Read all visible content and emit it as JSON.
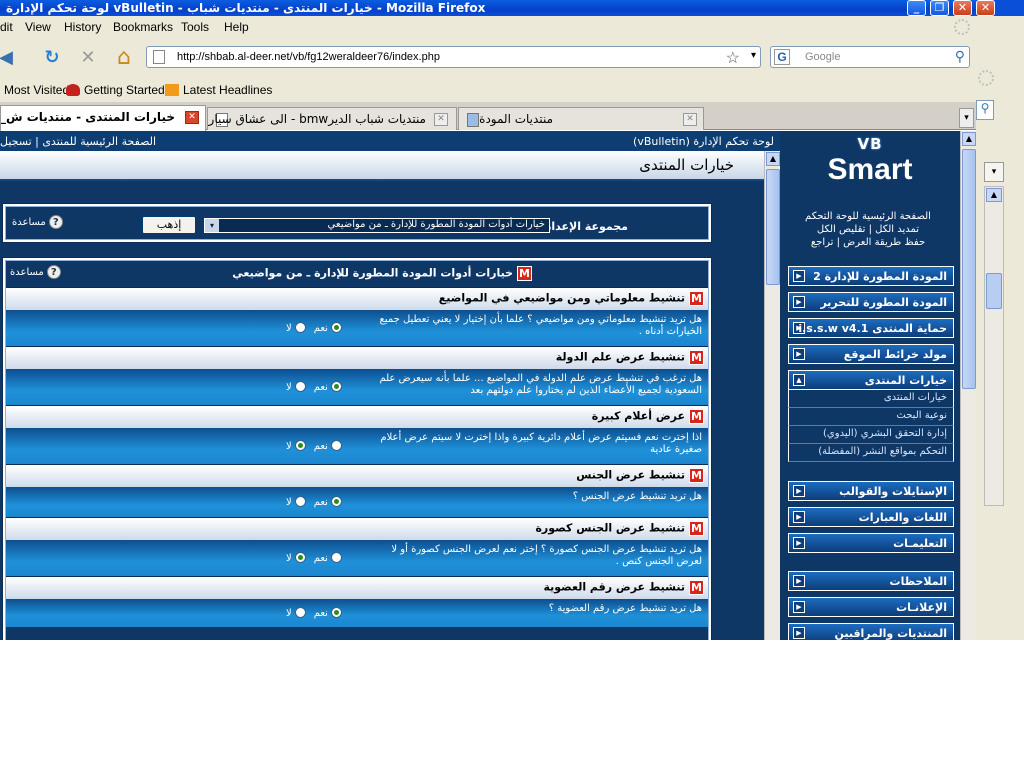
{
  "window": {
    "title": "لوحة تحكم الإدارة vBulletin - خيارات المنتدى - منتديات شباب - Mozilla Firefox",
    "minimize_glyph": "_",
    "maximize_glyph": "❐",
    "close_glyph": "✕"
  },
  "menu": [
    "dit",
    "View",
    "History",
    "Bookmarks",
    "Tools",
    "Help"
  ],
  "nav": {
    "back_glyph": "◀",
    "reload_glyph": "↻",
    "stop_glyph": "✕",
    "home_glyph": "⌂",
    "url": "http://shbab.al-deer.net/vb/fg12weraldeer76/index.php",
    "star_glyph": "☆",
    "dropdown_glyph": "▾",
    "search_engine_glyph": "G",
    "search_placeholder": "Google",
    "search_glyph": "⚲"
  },
  "bookmarks": [
    "Most Visited",
    "Getting Started",
    "Latest Headlines"
  ],
  "tabs": [
    {
      "label": "خيارات المنتدى - منتديات ش_",
      "active": true
    },
    {
      "label": "منتديات شباب الديرbmw - الى عشاق سيارة",
      "active": false
    },
    {
      "label": "منتديات المودة",
      "active": false
    }
  ],
  "tab_close_glyph": "✕",
  "topbar": {
    "left": "الصفحة الرئيسية للمنتدى | تسجيل",
    "right": "لوحة تحكم الإدارة (vBulletin)"
  },
  "page_title": "خيارات المنتدى",
  "settings_group": {
    "label": "مجموعة الإعداد",
    "selected": "خيارات أدوات المودة المطورة للإدارة ـ من مواضيعي",
    "go_label": "إذهب",
    "help_label": "مساعدة",
    "help_glyph": "?"
  },
  "section": {
    "title": "خيارات أدوات المودة المطورة للإدارة ـ من مواضيعي",
    "help_label": "مساعدة",
    "badge": "M"
  },
  "options": {
    "yes": "نعم",
    "no": "لا"
  },
  "settings": [
    {
      "title": "تنشيط معلوماتي ومن مواضيعي في المواضيع",
      "question": "هل تريد تنشيط معلوماتي ومن مواضيعي ؟ علما بأن إختيار لا يعني تعطيل جميع الخيارات أدناه .",
      "value": "yes"
    },
    {
      "title": "تنشيط عرض علم الدولة",
      "question": "هل ترغب في تنشيط عرض علم الدولة في المواضيع ... علما بأنه سيعرض علم السعودية لجميع الأعضاء الذين لم يختاروا علم دولتهم بعد",
      "value": "yes"
    },
    {
      "title": "عرض أعلام كبيرة",
      "question": "اذا إخترت نعم فسيتم عرض أعلام دائرية كبيرة واذا إخترت لا سيتم عرض أعلام صغيرة عادية",
      "value": "no"
    },
    {
      "title": "تنشيط عرض الجنس",
      "question": "هل تريد تنشيط عرض الجنس ؟",
      "value": "yes"
    },
    {
      "title": "تنشيط عرض الجنس كصورة",
      "question": "هل تريد تنشيط عرض الجنس كصورة ؟ إختر نعم لعرض الجنس كصورة أو لا لعرض الجنس كنص .",
      "value": "no"
    },
    {
      "title": "تنشيط عرض رقم العضوية",
      "question": "هل تريد تنشيط عرض رقم العضوية ؟",
      "value": "yes"
    }
  ],
  "sidebar": {
    "logo_top": "VB",
    "logo_brand": "Smart",
    "links": [
      "الصفحة الرئيسية للوحة التحكم",
      "تمديد الكل | تقليص الكل",
      "حفظ طريقة العرض | تراجع"
    ],
    "menus_a": [
      "المودة المطورة للإدارة 2",
      "المودة المطورة للتحرير",
      "حماية المنتدى i.s.s.w v4.1",
      "مولد خرائط الموقع"
    ],
    "open_menu": "خيارات المنتدى",
    "open_items": [
      "خيارات المنتدى",
      "نوعية البحث",
      "إدارة التحقق البشري (اليدوي)",
      "التحكم بمواقع النشر (المفضلة)"
    ],
    "menus_b": [
      "الإستايلات والقوالب",
      "اللغات والعبارات",
      "التعليمـات"
    ],
    "menus_c": [
      "الملاحظات",
      "الإعلانـات",
      "المنتديات والمراقبين"
    ],
    "arrow_closed": "▶",
    "arrow_open": "▲"
  },
  "scroll_up_glyph": "▲"
}
